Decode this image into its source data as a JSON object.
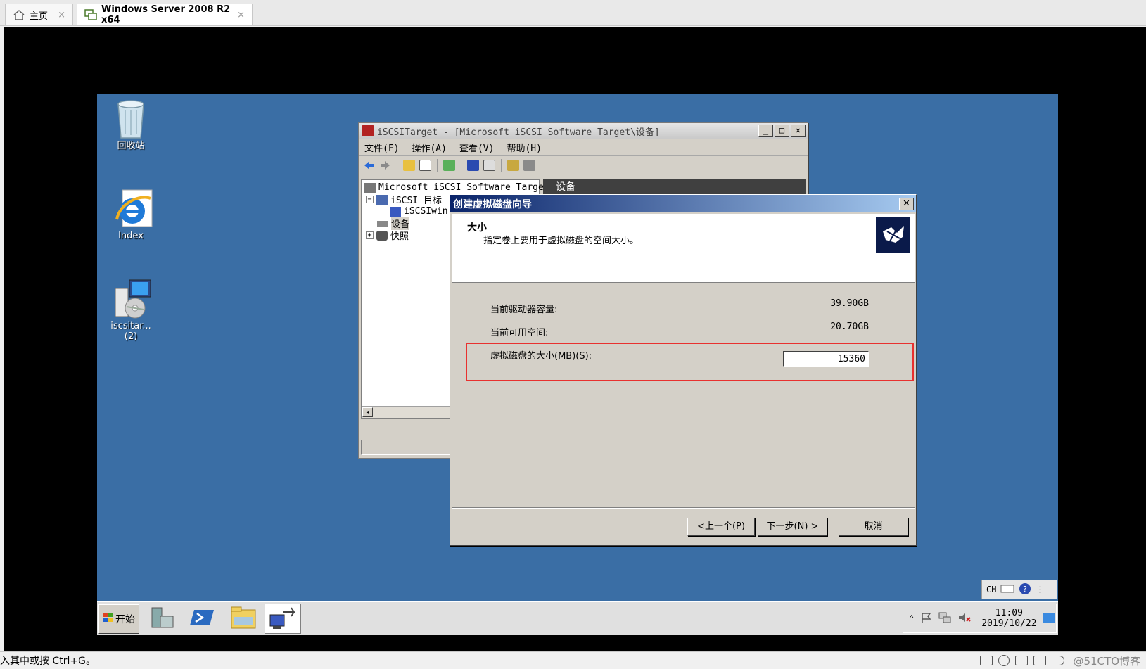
{
  "host": {
    "tabs": [
      {
        "label": "主页",
        "icon": "home-icon"
      },
      {
        "label": "Windows Server 2008 R2 x64",
        "icon": "vm-icon"
      }
    ],
    "close_glyph": "×",
    "status_text": "入其中或按 Ctrl+G。",
    "watermark": "@51CTO博客"
  },
  "desktop": {
    "icons": [
      {
        "label": "回收站",
        "icon": "recycle-bin-icon"
      },
      {
        "label": "Index",
        "icon": "internet-explorer-icon"
      },
      {
        "label": "iscsitar...",
        "label2": "(2)",
        "icon": "installer-icon"
      }
    ]
  },
  "mmc": {
    "title": "iSCSITarget - [Microsoft iSCSI Software Target\\设备]",
    "menu": [
      "文件(F)",
      "操作(A)",
      "查看(V)",
      "帮助(H)"
    ],
    "tree": [
      {
        "label": "Microsoft iSCSI Software Targe",
        "expander": ""
      },
      {
        "label": "iSCSI 目标",
        "expander": "−"
      },
      {
        "label": "iSCSIwin",
        "expander": ""
      },
      {
        "label": "设备",
        "expander": ""
      },
      {
        "label": "快照",
        "expander": "+"
      }
    ],
    "right_header": "设备"
  },
  "wizard": {
    "title": "创建虚拟磁盘向导",
    "header_title": "大小",
    "header_subtitle": "指定卷上要用于虚拟磁盘的空间大小。",
    "current_capacity_label": "当前驱动器容量:",
    "current_capacity_value": "39.90GB",
    "available_label": "当前可用空间:",
    "available_value": "20.70GB",
    "size_label": "虚拟磁盘的大小(MB)(S):",
    "size_value": "15360",
    "buttons": {
      "back": "<上一个(P)",
      "next": "下一步(N) >",
      "cancel": "取消"
    }
  },
  "langbar": {
    "lang": "CH"
  },
  "taskbar": {
    "start_label": "开始",
    "apps": [
      "server-manager-icon",
      "powershell-icon",
      "explorer-folder-icon",
      "iscsi-target-icon"
    ],
    "clock_time": "11:09",
    "clock_date": "2019/10/22"
  }
}
